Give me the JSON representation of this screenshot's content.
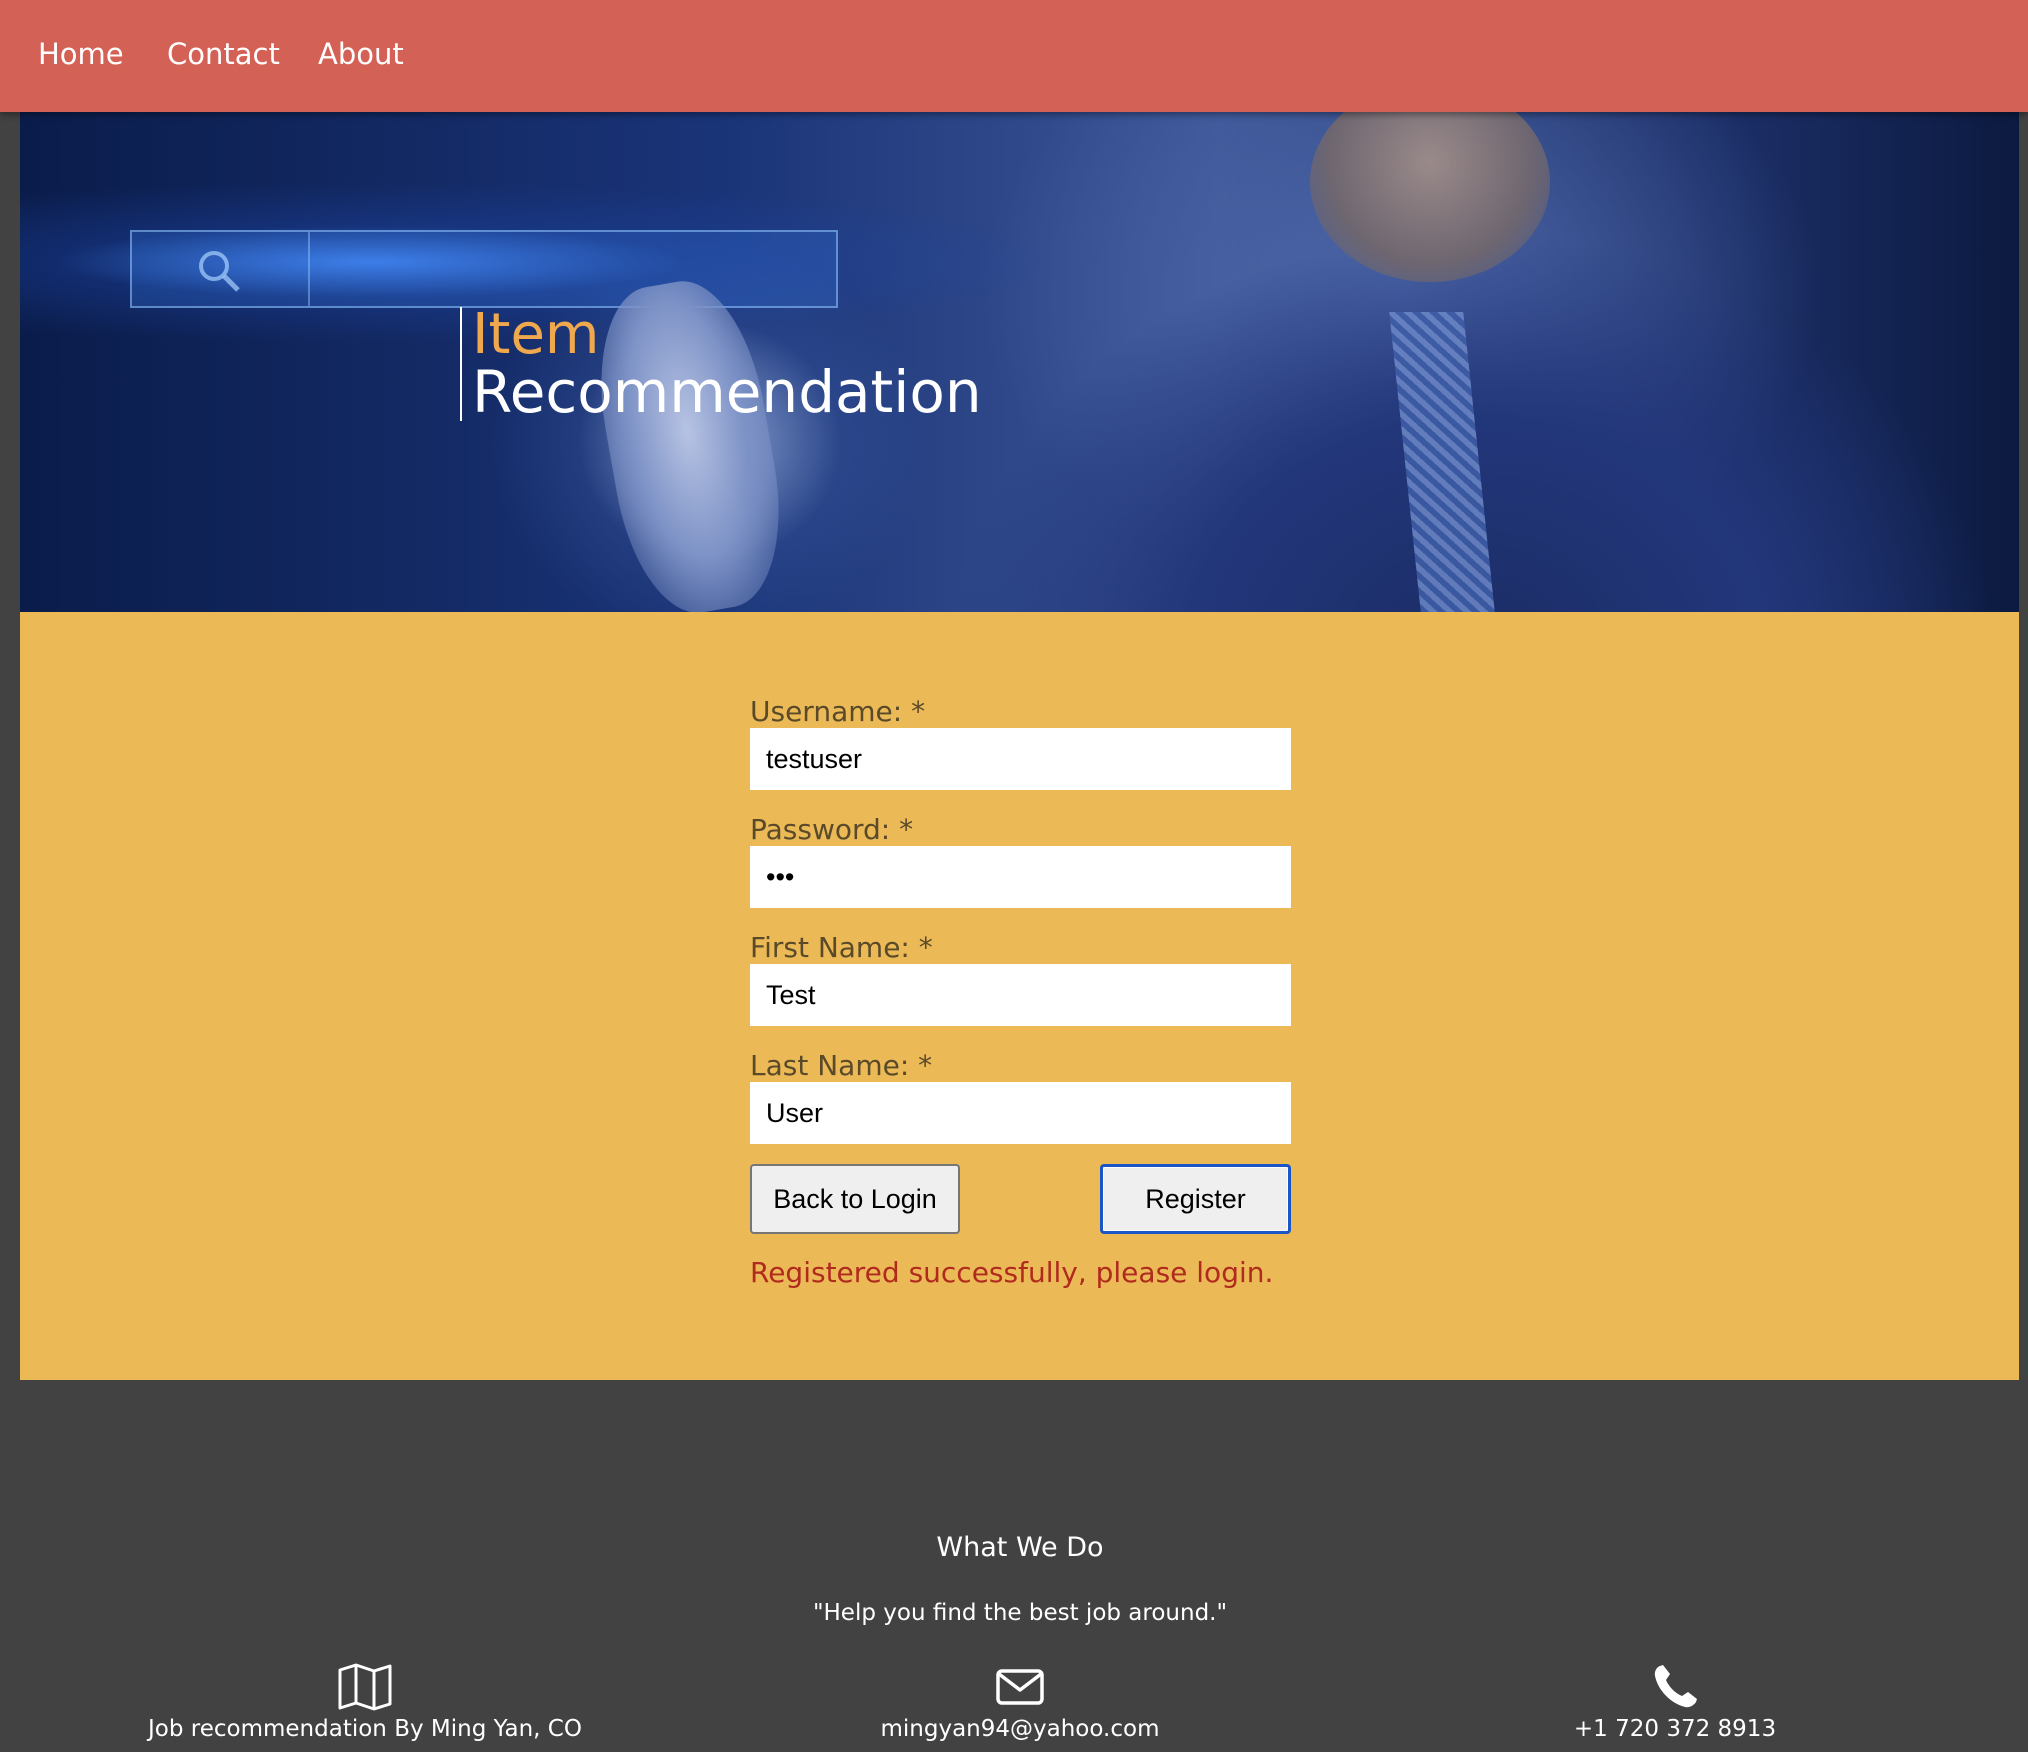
{
  "nav": {
    "items": [
      {
        "label": "Home"
      },
      {
        "label": "Contact"
      },
      {
        "label": "About"
      }
    ]
  },
  "hero": {
    "title_line1": "Item",
    "title_line2": "Recommendation",
    "colors": {
      "accent": "#f0a84e"
    }
  },
  "form": {
    "fields": [
      {
        "label": "Username: *",
        "value": "testuser",
        "type": "text"
      },
      {
        "label": "Password: *",
        "value": "•••",
        "type": "password"
      },
      {
        "label": "First Name: *",
        "value": "Test",
        "type": "text"
      },
      {
        "label": "Last Name: *",
        "value": "User",
        "type": "text"
      }
    ],
    "back_button": "Back to Login",
    "register_button": "Register",
    "status_message": "Registered successfully, please login.",
    "colors": {
      "background": "#ebba57",
      "status": "#b02a1e"
    }
  },
  "footer": {
    "heading": "What We Do",
    "quote": "\"Help you find the best job around.\"",
    "columns": [
      {
        "icon": "map-icon",
        "text": "Job recommendation By Ming Yan, CO"
      },
      {
        "icon": "envelope-icon",
        "text": "mingyan94@yahoo.com"
      },
      {
        "icon": "phone-icon",
        "text": "+1 720 372 8913"
      }
    ]
  },
  "colors": {
    "nav": "#d46155",
    "footer": "#424242"
  }
}
